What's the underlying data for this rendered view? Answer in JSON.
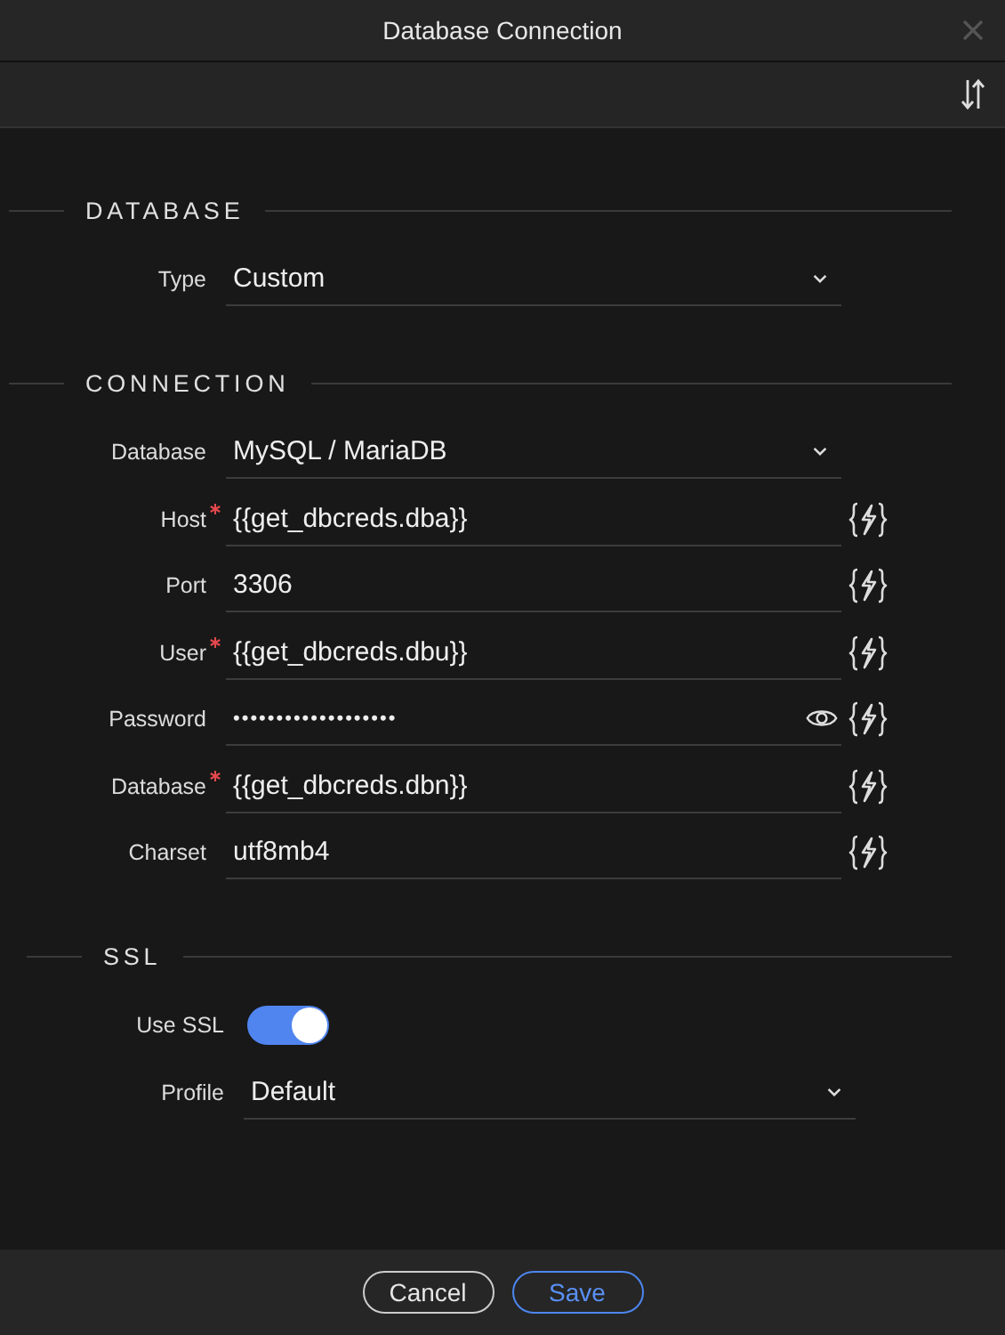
{
  "window": {
    "title": "Database Connection"
  },
  "sections": [
    {
      "title": "DATABASE",
      "rows": [
        {
          "label": "Type",
          "kind": "select",
          "value": "Custom",
          "required": false,
          "dynamic": false
        }
      ]
    },
    {
      "title": "CONNECTION",
      "rows": [
        {
          "label": "Database",
          "kind": "select",
          "value": "MySQL / MariaDB",
          "required": false,
          "dynamic": false
        },
        {
          "label": "Host",
          "kind": "text",
          "value": "{{get_dbcreds.dba}}",
          "required": true,
          "dynamic": true
        },
        {
          "label": "Port",
          "kind": "text",
          "value": "3306",
          "required": false,
          "dynamic": true
        },
        {
          "label": "User",
          "kind": "text",
          "value": "{{get_dbcreds.dbu}}",
          "required": true,
          "dynamic": true
        },
        {
          "label": "Password",
          "kind": "password",
          "value": "•••••••••••••••••••",
          "required": false,
          "dynamic": true
        },
        {
          "label": "Database",
          "kind": "text",
          "value": "{{get_dbcreds.dbn}}",
          "required": true,
          "dynamic": true
        },
        {
          "label": "Charset",
          "kind": "text",
          "value": "utf8mb4",
          "required": false,
          "dynamic": true
        }
      ]
    },
    {
      "title": "SSL",
      "rows": [
        {
          "label": "Use SSL",
          "kind": "toggle",
          "on": true
        },
        {
          "label": "Profile",
          "kind": "select",
          "value": "Default",
          "required": false,
          "dynamic": false
        }
      ]
    }
  ],
  "buttons": [
    {
      "label": "Cancel",
      "primary": false
    },
    {
      "label": "Save",
      "primary": true
    }
  ]
}
